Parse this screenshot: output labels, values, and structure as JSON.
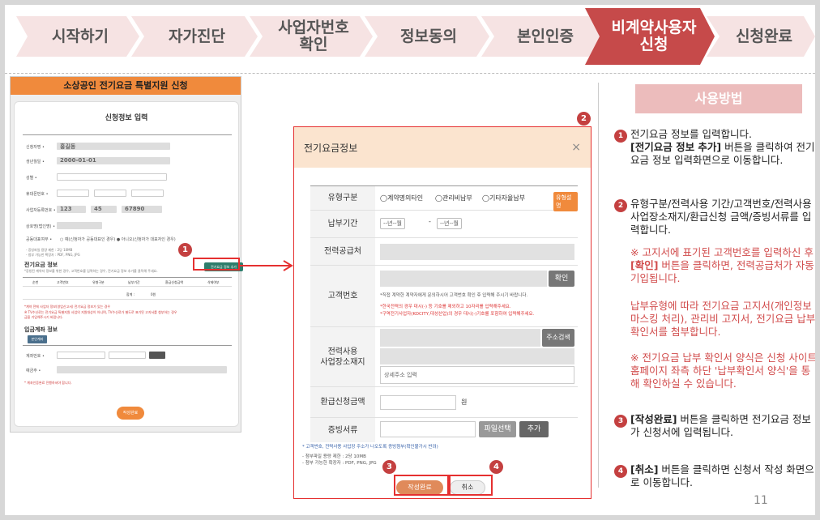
{
  "steps": [
    {
      "label": "시작하기",
      "active": false
    },
    {
      "label": "자가진단",
      "active": false
    },
    {
      "label": "사업자번호\n확인",
      "active": false
    },
    {
      "label": "정보동의",
      "active": false
    },
    {
      "label": "본인인증",
      "active": false
    },
    {
      "label": "비계약사용자\n신청",
      "active": true
    },
    {
      "label": "신청완료",
      "active": false
    }
  ],
  "colors": {
    "step_bg": "#f6e3e3",
    "step_active": "#c64a4a",
    "accent_orange": "#f08a3c",
    "badge": "#c44040"
  },
  "mock": {
    "header": "소상공인 전기요금 특별지원 신청",
    "title": "신청정보 입력",
    "name_value": "홍길동",
    "birth_value": "2000-01-01",
    "bizno_values": [
      "123",
      "45",
      "67890"
    ],
    "elec_info_title": "전기요금 정보",
    "add_button": "전기요금 정보 추가",
    "refund_title": "입금계좌 정보",
    "submit": "작성완료"
  },
  "modal": {
    "title": "전기요금정보",
    "close": "×",
    "type_label": "유형구분",
    "type_options": [
      "계약명의타인",
      "관리비납부",
      "기타자율납부"
    ],
    "type_tag": "유형설명",
    "period_label": "납부기간",
    "period_from": "--년--월",
    "period_to": "--년--월",
    "supplier_label": "전력공급처",
    "customer_label": "고객번호",
    "confirm_button": "확인",
    "customer_note1": "*직접 계약한 계약자에게 문의하시어 고객번호 확인 후 입력해 주시기 바랍니다.",
    "customer_note2": "*한국전력의 경우 대시(-) 등 기호를 제외하고 10자리를 입력해주세요.",
    "customer_note3": "*구역전기사업자(KOCITY,대성산업)의 경우 대시(-)기호를 포함하여 입력해주세요.",
    "address_label": "전력사용\n사업장소재지",
    "address_search_button": "주소검색",
    "address_detail_placeholder": "상세주소 입력",
    "refund_label": "환급신청금액",
    "refund_unit": "원",
    "evidence_label": "증빙서류",
    "file_button": "파일선택",
    "add_button": "추가",
    "evidence_note": "* 고객번호, 전력사용 사업장 주소가 나오도록 증빙첨부(확인불가시 반려)",
    "file_limit": "- 첨부파일 용량 제한 : 2당 10MB",
    "file_ext": "- 첨부 가능한 확장자 : PDF, PNG, JPG",
    "submit_button": "작성완료",
    "cancel_button": "취소"
  },
  "badges": [
    "1",
    "2",
    "3",
    "4"
  ],
  "usage": {
    "title": "사용방법",
    "item1_a": "전기요금 정보를 입력합니다.",
    "item1_b": "[전기요금 정보 추가]",
    "item1_c": " 버튼을 클릭하여 전기요금 정보 입력화면으로 이동합니다.",
    "item2": "유형구분/전력사용 기간/고객번호/전력사용 사업장소재지/환급신청 금액/증빙서류를 입력합니다.",
    "item2_note1_a": "※ 고지서에 표기된 고객번호를 입력하신 후 ",
    "item2_note1_b": "[확인]",
    "item2_note1_c": " 버튼을 클릭하면, 전력공급처가 자동 기입됩니다.",
    "item2_note2": "납부유형에 따라 전기요금 고지서(개인정보 마스킹 처리), 관리비 고지서, 전기요금 납부 확인서를 첨부합니다.",
    "item2_note3": "※ 전기요금 납부 확인서 양식은 신청 사이트 홈페이지 좌측 하단 '납부확인서 양식'을 통해 확인하실 수 있습니다.",
    "item3_b": "[작성완료]",
    "item3_c": " 버튼을 클릭하면 전기요금 정보가 신청서에 입력됩니다.",
    "item4_b": "[취소]",
    "item4_c": " 버튼을 클릭하면 신청서 작성 화면으로 이동합니다."
  },
  "page_number": "11"
}
